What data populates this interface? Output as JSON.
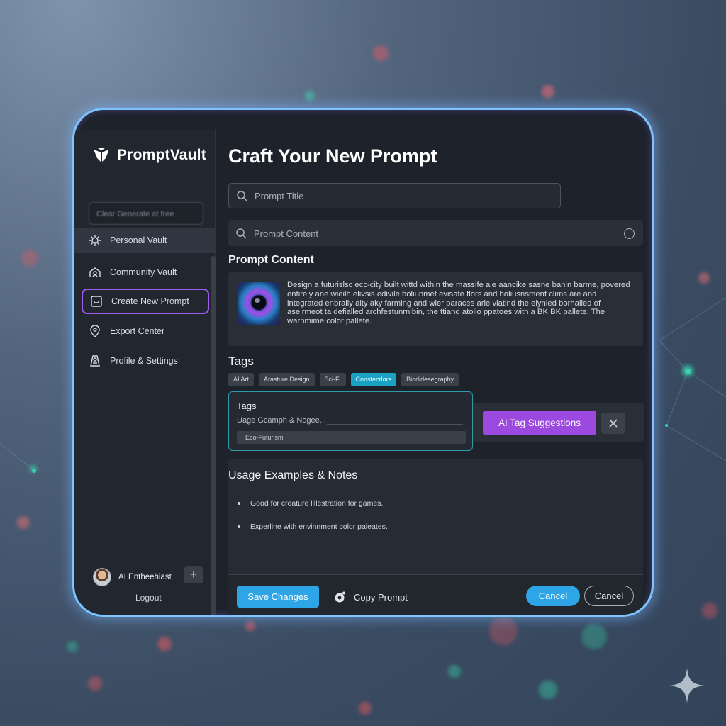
{
  "app": {
    "name": "PromptVault"
  },
  "sidebar": {
    "search_placeholder": "Clear Generate at free",
    "items": [
      {
        "label": "Personal Vault",
        "icon": "personal-vault-icon"
      },
      {
        "label": "Community Vault",
        "icon": "community-icon"
      },
      {
        "label": "Create New Prompt",
        "icon": "create-icon"
      },
      {
        "label": "Export Center",
        "icon": "export-icon"
      },
      {
        "label": "Profile & Settings",
        "icon": "profile-icon"
      }
    ],
    "user_name": "AI Entheehiast",
    "add_label": "+",
    "logout_label": "Logout"
  },
  "main": {
    "title": "Craft Your New Prompt",
    "title_field_placeholder": "Prompt Title",
    "content_field_placeholder": "Prompt Content",
    "content_section_label": "Prompt Content",
    "content_text": "Design a futurislsc ecc-city built wittd within the massife ale aancike sasne banin barme, povered entirely ane wieilh elivsis edivile boliunmet evisate flors and boliusnsment clims are and integrated enbrally alty aky farming and wier paraces arie viatind the elynled borhalied of aseirmeot ta defialled archfestunrnibin, the ttiand atolio ppatoes with a BK BK pallete. The warnmime color pallete.",
    "tags_label": "Tags",
    "tags": [
      "AI Art",
      "Arasture Design",
      "Sci-Fi",
      "Constecrlors",
      "Biodidesegraphy"
    ],
    "active_tag_index": 3,
    "tag_panel": {
      "title": "Tags",
      "input_text": "Uage Gcamph & Nogee...",
      "chip": "Eco-Futurism"
    },
    "ai_button_label": "AI Tag Suggestions",
    "notes_title": "Usage Examples & Notes",
    "notes": [
      "Good for creature lillestration for games.",
      "Experline with envinnment color paleates."
    ],
    "save_label": "Save Changes",
    "copy_label": "Copy Prompt",
    "cancel_primary_label": "Cancel",
    "cancel_secondary_label": "Cancel"
  },
  "colors": {
    "accent_blue": "#2ea5e6",
    "accent_purple": "#9c49e0",
    "active_tag": "#1aa2c2",
    "frame_glow": "#7dc4ff"
  }
}
